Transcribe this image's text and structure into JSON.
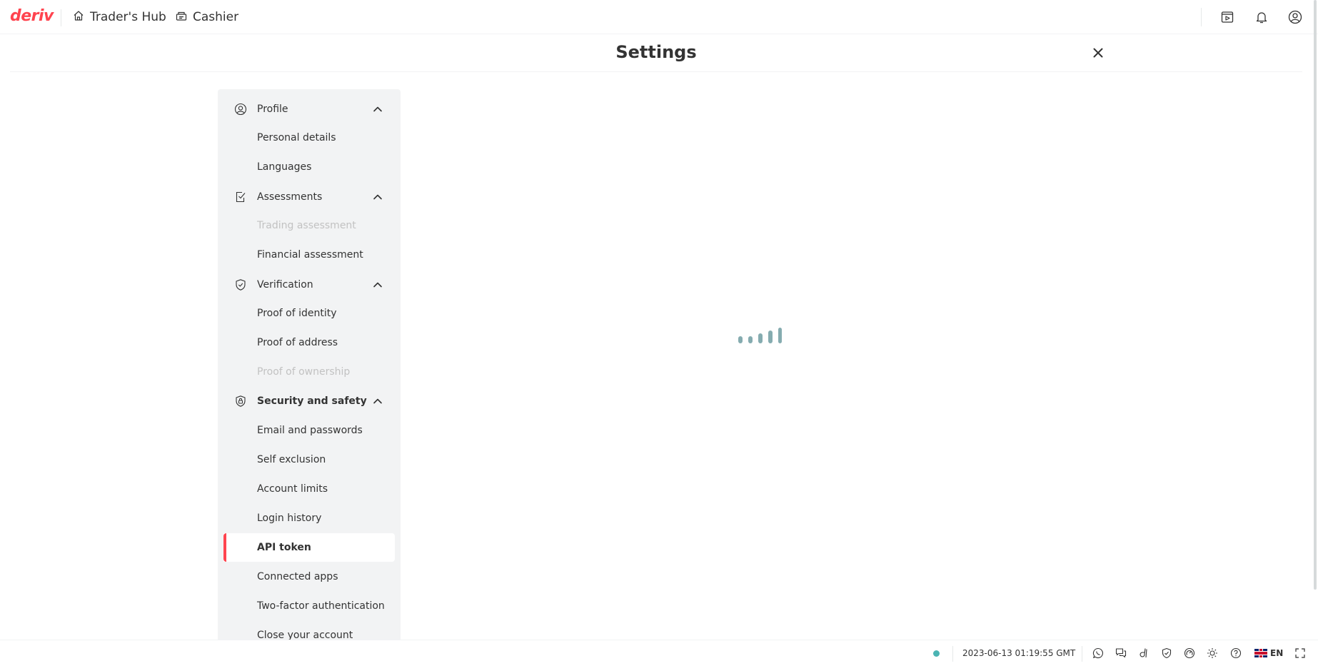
{
  "header": {
    "logo": "deriv",
    "nav": [
      {
        "label": "Trader's Hub",
        "icon": "home-icon"
      },
      {
        "label": "Cashier",
        "icon": "cashier-icon"
      }
    ],
    "right_icons": [
      "reports-icon",
      "notifications-bell-icon",
      "account-profile-icon"
    ]
  },
  "settings": {
    "title": "Settings"
  },
  "sidebar": {
    "groups": [
      {
        "label": "Profile",
        "icon": "profile-icon",
        "expanded": true,
        "items": [
          {
            "label": "Personal details",
            "state": "normal"
          },
          {
            "label": "Languages",
            "state": "normal"
          }
        ]
      },
      {
        "label": "Assessments",
        "icon": "assessments-icon",
        "expanded": true,
        "items": [
          {
            "label": "Trading assessment",
            "state": "disabled"
          },
          {
            "label": "Financial assessment",
            "state": "normal"
          }
        ]
      },
      {
        "label": "Verification",
        "icon": "verification-shield-icon",
        "expanded": true,
        "items": [
          {
            "label": "Proof of identity",
            "state": "normal"
          },
          {
            "label": "Proof of address",
            "state": "normal"
          },
          {
            "label": "Proof of ownership",
            "state": "disabled"
          }
        ]
      },
      {
        "label": "Security and safety",
        "icon": "security-lock-icon",
        "expanded": true,
        "active_group": true,
        "items": [
          {
            "label": "Email and passwords",
            "state": "normal"
          },
          {
            "label": "Self exclusion",
            "state": "normal"
          },
          {
            "label": "Account limits",
            "state": "normal"
          },
          {
            "label": "Login history",
            "state": "normal"
          },
          {
            "label": "API token",
            "state": "active"
          },
          {
            "label": "Connected apps",
            "state": "normal"
          },
          {
            "label": "Two-factor authentication",
            "state": "normal"
          },
          {
            "label": "Close your account",
            "state": "normal"
          }
        ]
      }
    ]
  },
  "main": {
    "loading": true
  },
  "footer": {
    "status": "online",
    "status_color": "#4bb4b3",
    "clock": "2023-06-13 01:19:55 GMT",
    "icons": [
      "whatsapp-icon",
      "livechat-icon",
      "deriv-go-icon",
      "responsible-trading-icon",
      "account-limits-icon",
      "theme-toggle-icon",
      "help-icon"
    ],
    "language": "EN",
    "fullscreen_icon": "fullscreen-icon"
  },
  "colors": {
    "brand": "#ff444f",
    "sidebar_bg": "#f2f3f4",
    "loader": "#85acb0"
  }
}
